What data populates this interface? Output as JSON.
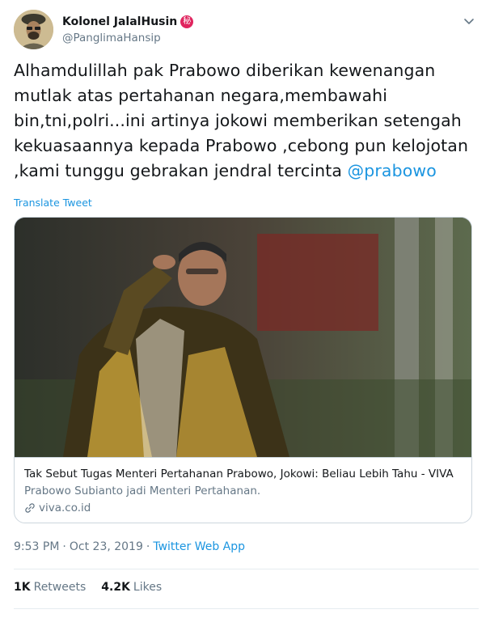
{
  "author": {
    "display_name": "Kolonel JalalHusin",
    "badge_glyph": "秘",
    "handle": "@PanglimaHansip",
    "avatar_icon": "avatar-photo"
  },
  "tweet": {
    "text_line1": "Alhamdulillah pak Prabowo diberikan kewenangan",
    "text_line2": "mutlak atas pertahanan negara,membawahi",
    "text_line3": "bin,tni,polri...ini artinya jokowi memberikan setengah",
    "text_line4": "kekuasaannya kepada Prabowo ,cebong pun kelojotan",
    "text_line5_prefix": ",kami tunggu gebrakan jendral tercinta ",
    "mention": "@prabowo",
    "translate_label": "Translate Tweet"
  },
  "card": {
    "title": "Tak Sebut Tugas Menteri Pertahanan Prabowo, Jokowi: Beliau Lebih Tahu - VIVA",
    "description": "Prabowo Subianto jadi Menteri Pertahanan.",
    "domain": "viva.co.id"
  },
  "meta": {
    "time": "9:53 PM",
    "separator": "·",
    "date": "Oct 23, 2019",
    "app": "Twitter Web App"
  },
  "stats": {
    "retweets_count": "1K",
    "retweets_label": "Retweets",
    "likes_count": "4.2K",
    "likes_label": "Likes"
  },
  "colors": {
    "link_blue": "#1b95e0",
    "secondary_text": "#657786",
    "border": "#ccd6dd",
    "badge_red": "#e0245e"
  }
}
